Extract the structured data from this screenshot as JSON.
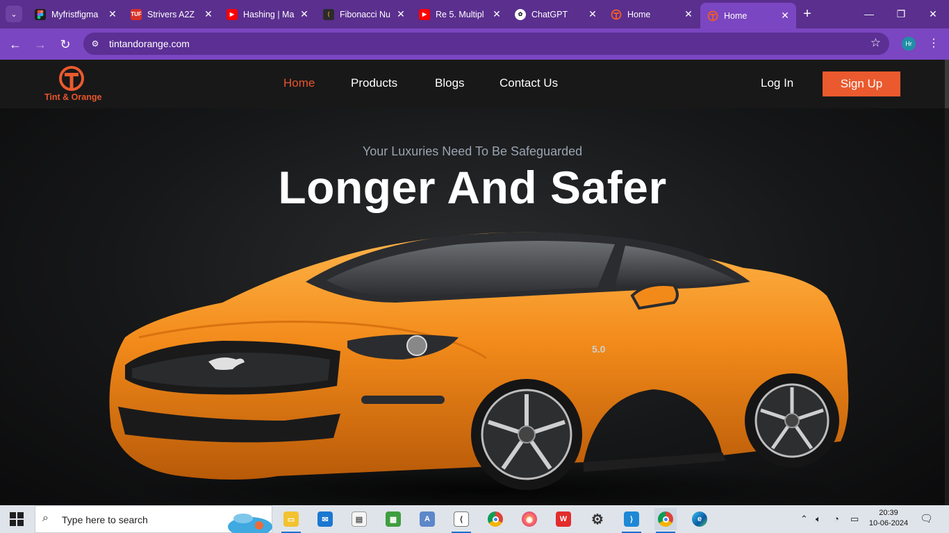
{
  "browser": {
    "tabs": [
      {
        "title": "Myfristfigma",
        "fav_icon": "figma-icon",
        "fav_color": "#a259ff"
      },
      {
        "title": "Strivers A2Z",
        "fav_icon": "tuf-icon",
        "fav_color": "#d93025"
      },
      {
        "title": "Hashing | Ma",
        "fav_icon": "youtube-icon",
        "fav_color": "#ff0000"
      },
      {
        "title": "Fibonacci Nu",
        "fav_icon": "leetcode-icon",
        "fav_color": "#f89f1b"
      },
      {
        "title": "Re 5. Multipl",
        "fav_icon": "youtube-icon",
        "fav_color": "#ff0000"
      },
      {
        "title": "ChatGPT",
        "fav_icon": "chatgpt-icon",
        "fav_color": "#ffffff"
      },
      {
        "title": "Home",
        "fav_icon": "tint-orange-icon",
        "fav_color": "#ea5a2e"
      },
      {
        "title": "Home",
        "fav_icon": "tint-orange-icon",
        "fav_color": "#ea5a2e",
        "active": true
      }
    ],
    "url": "tintandorange.com",
    "profile_initials": "Hr",
    "theme_color": "#7b46c1"
  },
  "site": {
    "brand": "Tint & Orange",
    "nav": [
      "Home",
      "Products",
      "Blogs",
      "Contact Us"
    ],
    "active_nav": "Home",
    "login_label": "Log In",
    "signup_label": "Sign Up",
    "accent_color": "#ea5a2e"
  },
  "hero": {
    "eyebrow": "Your Luxuries Need To Be Safeguarded",
    "headline": "Longer And Safer",
    "car_color": "#f28a1a",
    "car_badge": "5.0"
  },
  "taskbar": {
    "search_placeholder": "Type here to search",
    "apps": [
      "file-explorer-icon",
      "mail-icon",
      "notepad-icon",
      "task-manager-icon",
      "wordpad-icon",
      "codeblocks-icon",
      "chrome-icon",
      "firefox-icon",
      "wps-office-icon",
      "settings-icon",
      "vscode-icon",
      "chrome-profile-icon",
      "edge-icon"
    ],
    "time": "20:39",
    "date": "10-06-2024"
  }
}
